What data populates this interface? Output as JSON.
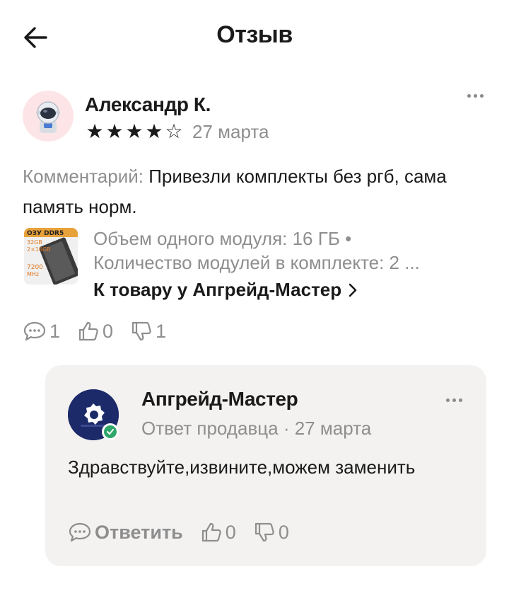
{
  "header": {
    "title": "Отзыв"
  },
  "review": {
    "author": "Александр К.",
    "rating": 4,
    "rating_max": 5,
    "date": "27 марта",
    "comment_label": "Комментарий:",
    "comment_text": "Привезли комплекты без ргб, сама память норм.",
    "product": {
      "thumb_text_lines": [
        "ОЗУ DDR5",
        "32GB",
        "2×16GB",
        "7200",
        "MHz"
      ],
      "spec_1": "Объем одного модуля: 16 ГБ •",
      "spec_2": "Количество модулей в комплекте: 2 ...",
      "link_label": "К товару у Апгрейд-Мастер"
    },
    "counts": {
      "comments": "1",
      "likes": "0",
      "dislikes": "1"
    }
  },
  "reply": {
    "seller_name": "Апгрейд-Мастер",
    "subtitle": "Ответ продавца · 27 марта",
    "text": "Здравствуйте,извините,можем заменить",
    "reply_label": "Ответить",
    "likes": "0",
    "dislikes": "0"
  },
  "colors": {
    "text": "#1a1a1a",
    "muted": "#8e8e8e",
    "reply_bg": "#f3f2f1",
    "verified": "#2fa66a"
  }
}
